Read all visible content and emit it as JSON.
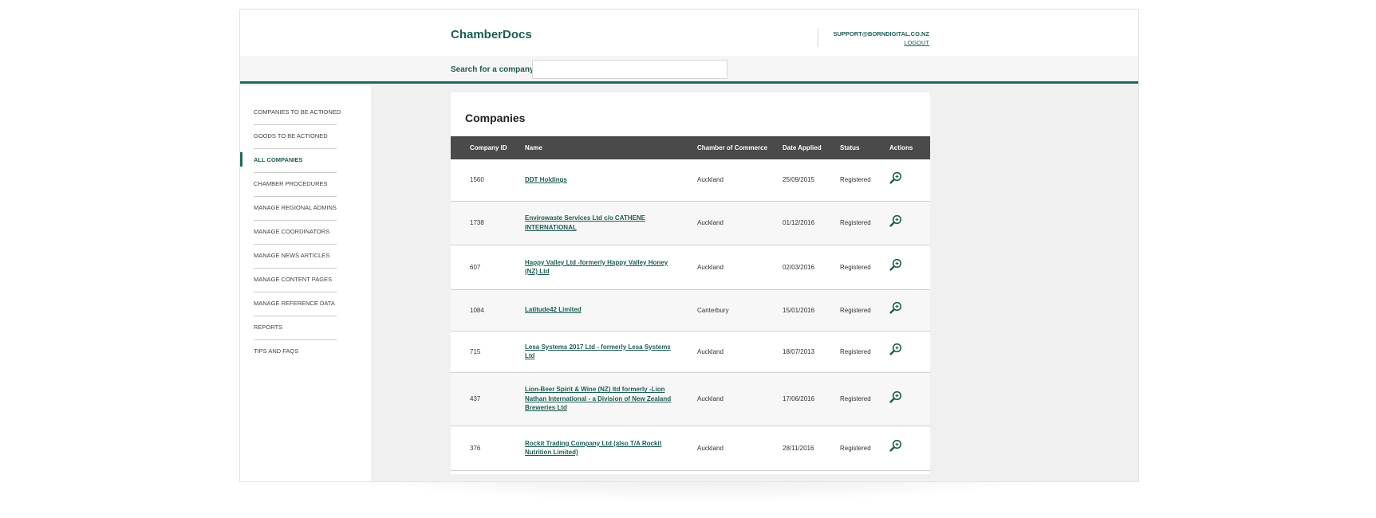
{
  "header": {
    "brand": "ChamberDocs",
    "account_email": "SUPPORT@BORNDIGITAL.CO.NZ",
    "logout_label": "LOGOUT"
  },
  "search": {
    "label": "Search for a company",
    "value": "",
    "placeholder": ""
  },
  "sidebar": {
    "items": [
      {
        "label": "COMPANIES TO BE ACTIONED",
        "active": false
      },
      {
        "label": "GOODS TO BE ACTIONED",
        "active": false
      },
      {
        "label": "ALL COMPANIES",
        "active": true
      },
      {
        "label": "CHAMBER PROCEDURES",
        "active": false
      },
      {
        "label": "MANAGE REGIONAL ADMINS",
        "active": false
      },
      {
        "label": "MANAGE COORDINATORS",
        "active": false
      },
      {
        "label": "MANAGE NEWS ARTICLES",
        "active": false
      },
      {
        "label": "MANAGE CONTENT PAGES",
        "active": false
      },
      {
        "label": "MANAGE REFERENCE DATA",
        "active": false
      },
      {
        "label": "REPORTS",
        "active": false
      },
      {
        "label": "TIPS AND FAQS",
        "active": false
      }
    ]
  },
  "main": {
    "title": "Companies",
    "columns": [
      "Company ID",
      "Name",
      "Chamber of Commerce",
      "Date Applied",
      "Status",
      "Actions"
    ],
    "action_icon": "search-zoom-icon",
    "rows": [
      {
        "id": "1560",
        "name": "DDT Holdings",
        "chamber": "Auckland",
        "date": "25/09/2015",
        "status": "Registered"
      },
      {
        "id": "1738",
        "name": "Envirowaste Services Ltd c/o CATHENE INTERNATIONAL",
        "chamber": "Auckland",
        "date": "01/12/2016",
        "status": "Registered"
      },
      {
        "id": "607",
        "name": "Happy Valley Ltd -formerly Happy Valley Honey (NZ) Ltd",
        "chamber": "Auckland",
        "date": "02/03/2016",
        "status": "Registered"
      },
      {
        "id": "1084",
        "name": "Latitude42 Limited",
        "chamber": "Canterbury",
        "date": "15/01/2016",
        "status": "Registered"
      },
      {
        "id": "715",
        "name": "Lesa Systems 2017 Ltd - formerly Lesa Systems Ltd",
        "chamber": "Auckland",
        "date": "18/07/2013",
        "status": "Registered"
      },
      {
        "id": "437",
        "name": "Lion-Beer Spirit & Wine (NZ) ltd formerly -Lion Nathan International - a Division of New Zealand Breweries Ltd",
        "chamber": "Auckland",
        "date": "17/06/2016",
        "status": "Registered"
      },
      {
        "id": "376",
        "name": "Rockit Trading Company Ltd (also T/A Rockit Nutrition Limited)",
        "chamber": "Auckland",
        "date": "28/11/2016",
        "status": "Registered"
      }
    ]
  },
  "colors": {
    "accent": "#1b5e55",
    "accent_bar": "#1b6b5f",
    "table_header_bg": "#4a4a4a",
    "page_bg": "#f0f0f0"
  }
}
